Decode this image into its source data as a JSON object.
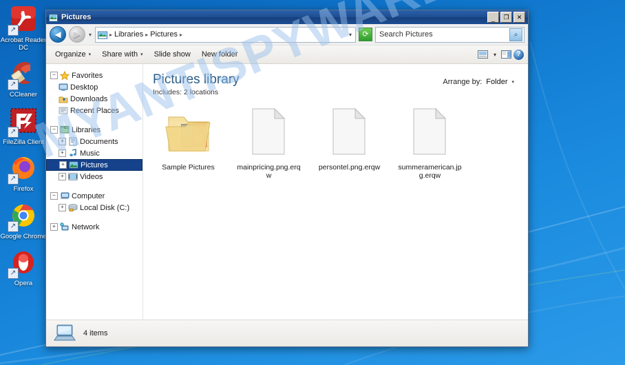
{
  "desktop": {
    "icons": [
      {
        "label": "Acrobat Reader DC",
        "icon": "acrobat-reader-icon"
      },
      {
        "label": "CCleaner",
        "icon": "ccleaner-icon"
      },
      {
        "label": "FileZilla Client",
        "icon": "filezilla-icon"
      },
      {
        "label": "Firefox",
        "icon": "firefox-icon"
      },
      {
        "label": "Google Chrome",
        "icon": "chrome-icon"
      },
      {
        "label": "Opera",
        "icon": "opera-icon"
      }
    ],
    "watermark": "MYANTISPYWARE.C"
  },
  "window": {
    "title": "Pictures",
    "title_icon": "pictures-library-icon",
    "controls": {
      "minimize": "_",
      "maximize": "❐",
      "close": "✕"
    }
  },
  "addressbar": {
    "back_icon": "back-arrow-icon",
    "forward_icon": "forward-arrow-icon",
    "history_caret": "▾",
    "folder_icon": "pictures-library-icon",
    "crumbs": [
      "Libraries",
      "Pictures"
    ],
    "separator": "▸",
    "dropdown_caret": "▾",
    "refresh_icon": "refresh-icon",
    "refresh_glyph": "⟳"
  },
  "search": {
    "value": "Search Pictures",
    "icon": "search-magnifier-icon",
    "glyph": "⌕"
  },
  "toolbar": {
    "organize": "Organize",
    "share_with": "Share with",
    "slide_show": "Slide show",
    "new_folder": "New folder",
    "caret": "▾",
    "view_icon": "change-view-icon",
    "view_caret": "▾",
    "preview_icon": "preview-pane-icon",
    "help_icon": "help-icon",
    "help_glyph": "?"
  },
  "navpane": {
    "groups": [
      {
        "label": "Favorites",
        "icon": "favorites-star-icon",
        "expander": "−",
        "items": [
          {
            "label": "Desktop",
            "icon": "desktop-icon",
            "expander": ""
          },
          {
            "label": "Downloads",
            "icon": "downloads-icon",
            "expander": ""
          },
          {
            "label": "Recent Places",
            "icon": "recent-places-icon",
            "expander": ""
          }
        ]
      },
      {
        "label": "Libraries",
        "icon": "libraries-icon",
        "expander": "−",
        "items": [
          {
            "label": "Documents",
            "icon": "documents-library-icon",
            "expander": "+"
          },
          {
            "label": "Music",
            "icon": "music-library-icon",
            "expander": "+"
          },
          {
            "label": "Pictures",
            "icon": "pictures-library-icon",
            "expander": "+",
            "selected": true
          },
          {
            "label": "Videos",
            "icon": "videos-library-icon",
            "expander": "+"
          }
        ]
      },
      {
        "label": "Computer",
        "icon": "computer-icon",
        "expander": "−",
        "items": [
          {
            "label": "Local Disk (C:)",
            "icon": "hard-disk-icon",
            "expander": "+"
          }
        ]
      },
      {
        "label": "Network",
        "icon": "network-icon",
        "expander": "+",
        "items": []
      }
    ]
  },
  "library": {
    "title": "Pictures library",
    "subtitle": "Includes:  2 locations",
    "arrange_label": "Arrange by:",
    "arrange_value": "Folder",
    "arrange_caret": "▾"
  },
  "files": [
    {
      "name": "Sample Pictures",
      "icon": "folder-with-pictures-icon",
      "type": "folder"
    },
    {
      "name": "mainpricing.png.erqw",
      "icon": "unknown-file-icon",
      "type": "file"
    },
    {
      "name": "persontel.png.erqw",
      "icon": "unknown-file-icon",
      "type": "file"
    },
    {
      "name": "summeramerican.jpg.erqw",
      "icon": "unknown-file-icon",
      "type": "file"
    }
  ],
  "statusbar": {
    "icon": "computer-status-icon",
    "text": "4 items"
  },
  "colors": {
    "desktop_blue": "#0f76cc",
    "title_blue": "#1f4f94",
    "selection_blue": "#15428b",
    "library_title": "#2b5b84",
    "watermark": "#96bee b"
  }
}
